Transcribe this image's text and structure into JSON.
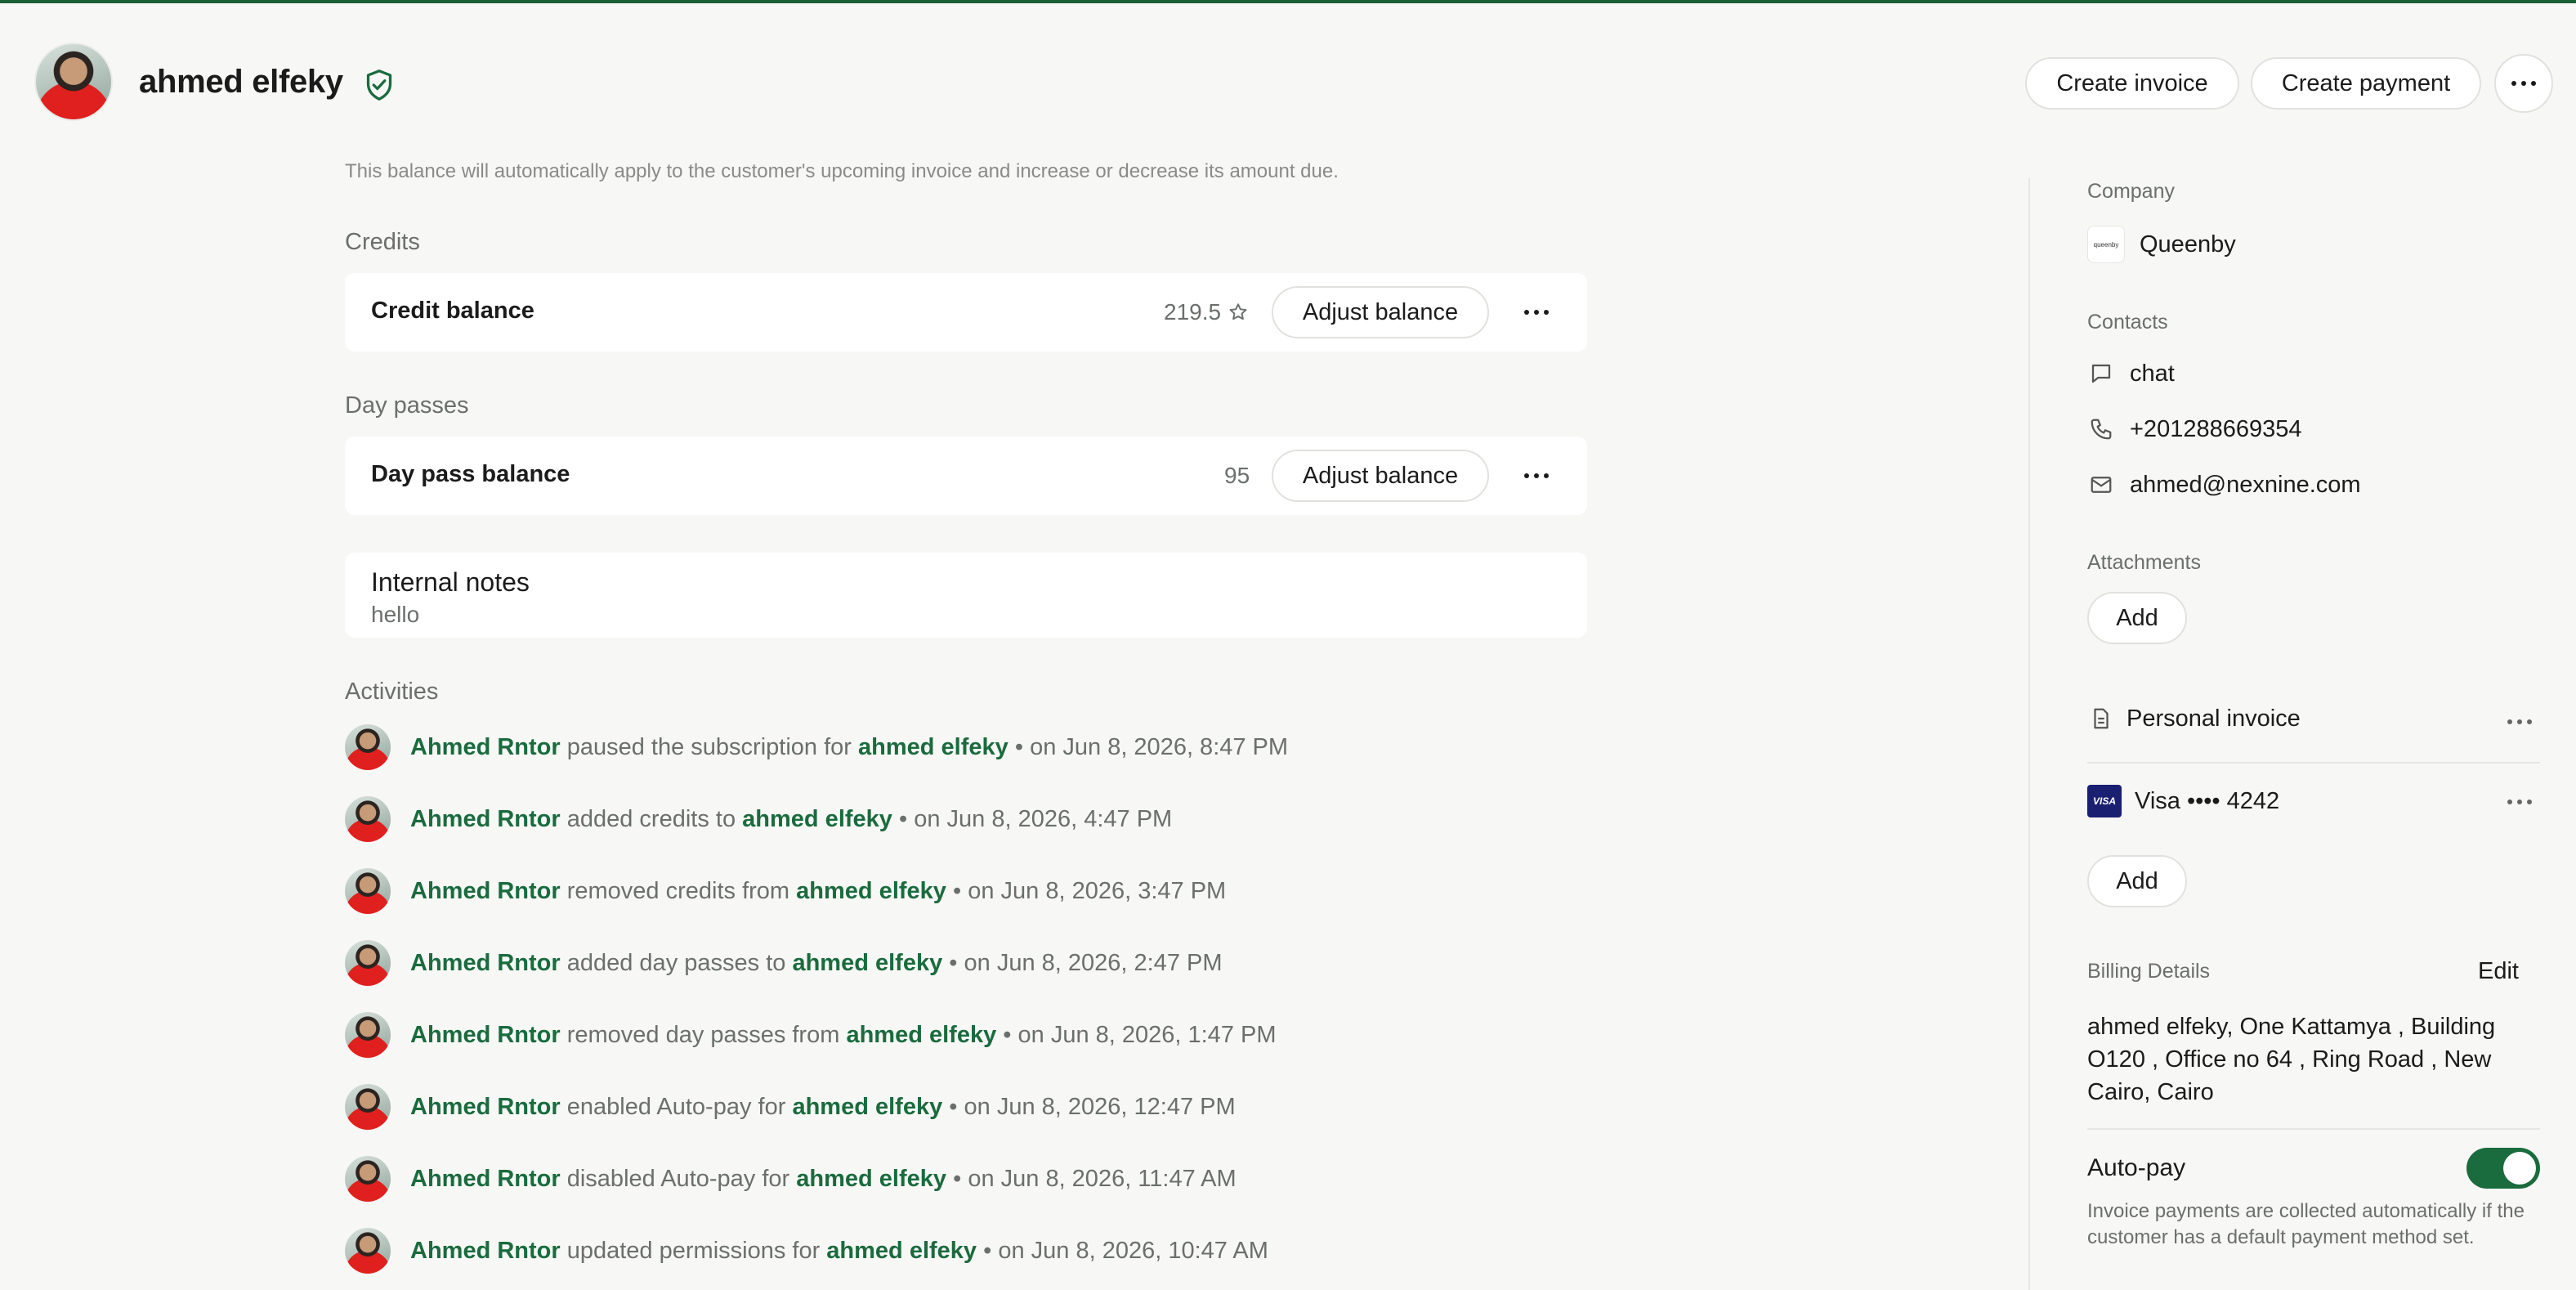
{
  "header": {
    "user_name": "ahmed elfeky",
    "create_invoice_label": "Create invoice",
    "create_payment_label": "Create payment"
  },
  "main": {
    "balance_note": "This balance will automatically apply to the customer's upcoming invoice and increase or decrease its amount due.",
    "credits": {
      "section_label": "Credits",
      "row_title": "Credit balance",
      "value": "219.5",
      "adjust_label": "Adjust balance"
    },
    "day_passes": {
      "section_label": "Day passes",
      "row_title": "Day pass balance",
      "value": "95",
      "adjust_label": "Adjust balance"
    },
    "notes": {
      "title": "Internal notes",
      "body": "hello"
    },
    "activities_label": "Activities",
    "activities": [
      {
        "actor": "Ahmed Rntor",
        "action": "paused the subscription for",
        "target": "ahmed elfeky",
        "time": "on Jun 8, 2026, 8:47 PM"
      },
      {
        "actor": "Ahmed Rntor",
        "action": "added credits to",
        "target": "ahmed elfeky",
        "time": "on Jun 8, 2026, 4:47 PM"
      },
      {
        "actor": "Ahmed Rntor",
        "action": "removed credits from",
        "target": "ahmed elfeky",
        "time": "on Jun 8, 2026, 3:47 PM"
      },
      {
        "actor": "Ahmed Rntor",
        "action": "added day passes to",
        "target": "ahmed elfeky",
        "time": "on Jun 8, 2026, 2:47 PM"
      },
      {
        "actor": "Ahmed Rntor",
        "action": "removed day passes from",
        "target": "ahmed elfeky",
        "time": "on Jun 8, 2026, 1:47 PM"
      },
      {
        "actor": "Ahmed Rntor",
        "action": "enabled Auto-pay for",
        "target": "ahmed elfeky",
        "time": "on Jun 8, 2026, 12:47 PM"
      },
      {
        "actor": "Ahmed Rntor",
        "action": "disabled Auto-pay for",
        "target": "ahmed elfeky",
        "time": "on Jun 8, 2026, 11:47 AM"
      },
      {
        "actor": "Ahmed Rntor",
        "action": "updated permissions for",
        "target": "ahmed elfeky",
        "time": "on Jun 8, 2026, 10:47 AM"
      }
    ]
  },
  "sidebar": {
    "company_label": "Company",
    "company_name": "Queenby",
    "company_logo_text": "queenby",
    "contacts_label": "Contacts",
    "contact_chat": "chat",
    "contact_phone": "+201288669354",
    "contact_email": "ahmed@nexnine.com",
    "attachments_label": "Attachments",
    "add_label": "Add",
    "personal_invoice": "Personal invoice",
    "visa_badge": "VISA",
    "card_label": "Visa •••• 4242",
    "billing_label": "Billing Details",
    "edit_label": "Edit",
    "billing_address": "ahmed elfeky, One Kattamya , Building O120 , Office no 64 , Ring Road , New Cairo, Cairo",
    "autopay_label": "Auto-pay",
    "autopay_enabled": true,
    "autopay_desc": "Invoice payments are collected automatically if the customer has a default payment method set."
  },
  "colors": {
    "accent": "#1a6b3d",
    "brand_line": "#1a5e36",
    "muted_text": "#6b6f6c"
  },
  "icons": [
    "verified-shield-icon",
    "more-dots-icon",
    "star-icon",
    "chat-icon",
    "phone-icon",
    "mail-icon",
    "document-icon",
    "visa-icon"
  ]
}
